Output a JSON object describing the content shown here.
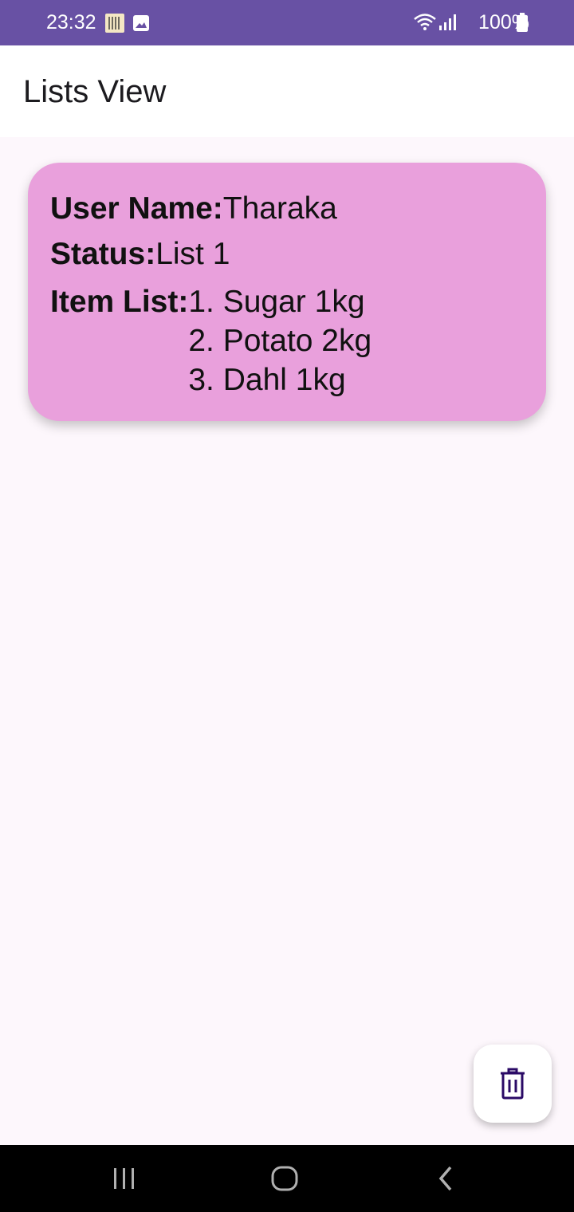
{
  "status_bar": {
    "time": "23:32",
    "battery": "100%",
    "icons": [
      "qr-notification-icon",
      "image-notification-icon",
      "wifi-icon",
      "signal-icon",
      "battery-icon"
    ]
  },
  "app_bar": {
    "title": "Lists View"
  },
  "card": {
    "user_label": "User Name:",
    "user_value": "Tharaka",
    "status_label": "Status:",
    "status_value": "List 1",
    "items_label": "Item List:",
    "items": [
      "1. Sugar 1kg",
      "2. Potato 2kg",
      "3. Dahl 1kg"
    ],
    "background": "#e9a0dc"
  },
  "fab": {
    "icon": "trash-icon",
    "color": "#2a0a66"
  },
  "nav_bar": {
    "buttons": [
      "recents-icon",
      "home-icon",
      "back-icon"
    ]
  },
  "colors": {
    "status_bar": "#6851a4",
    "page_bg": "#fdf7fc"
  }
}
